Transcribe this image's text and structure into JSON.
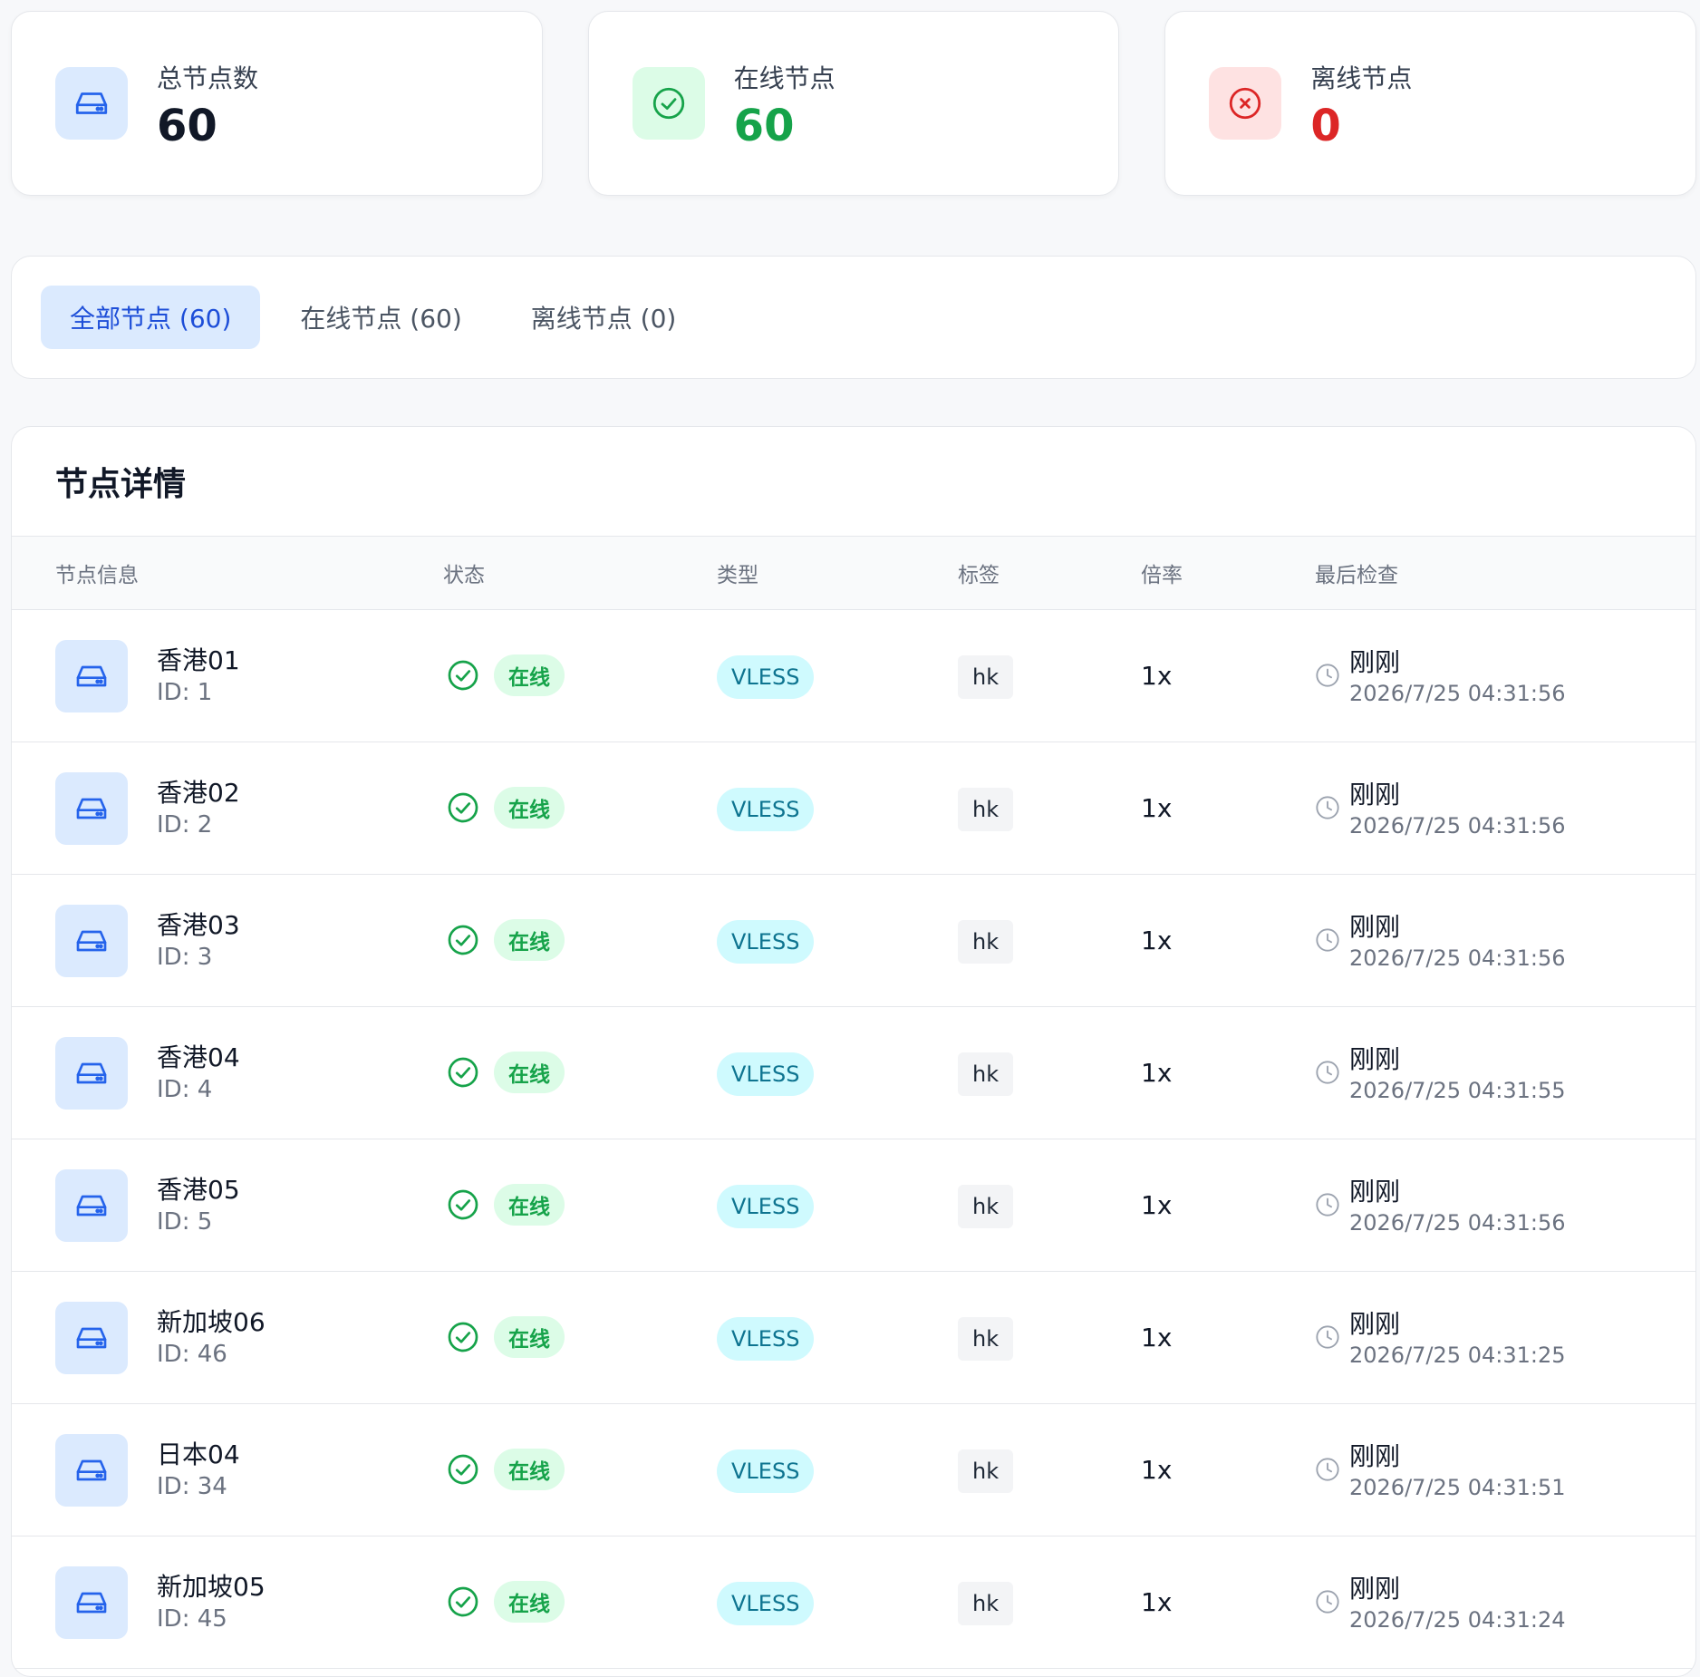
{
  "colors": {
    "blue": "#2563eb",
    "green": "#16a34a",
    "red": "#dc2626"
  },
  "stats": [
    {
      "label": "总节点数",
      "value": "60",
      "icon": "server-icon"
    },
    {
      "label": "在线节点",
      "value": "60",
      "icon": "check-circle-icon"
    },
    {
      "label": "离线节点",
      "value": "0",
      "icon": "x-circle-icon"
    }
  ],
  "tabs": [
    {
      "label": "全部节点 (60)",
      "active": true
    },
    {
      "label": "在线节点 (60)",
      "active": false
    },
    {
      "label": "离线节点 (0)",
      "active": false
    }
  ],
  "detail": {
    "title": "节点详情",
    "columns": [
      "节点信息",
      "状态",
      "类型",
      "标签",
      "倍率",
      "最后检查"
    ]
  },
  "nodes": [
    {
      "name": "香港01",
      "id": "ID: 1",
      "status": "在线",
      "type": "VLESS",
      "tag": "hk",
      "rate": "1x",
      "last": "刚刚",
      "time": "2026/7/25 04:31:56"
    },
    {
      "name": "香港02",
      "id": "ID: 2",
      "status": "在线",
      "type": "VLESS",
      "tag": "hk",
      "rate": "1x",
      "last": "刚刚",
      "time": "2026/7/25 04:31:56"
    },
    {
      "name": "香港03",
      "id": "ID: 3",
      "status": "在线",
      "type": "VLESS",
      "tag": "hk",
      "rate": "1x",
      "last": "刚刚",
      "time": "2026/7/25 04:31:56"
    },
    {
      "name": "香港04",
      "id": "ID: 4",
      "status": "在线",
      "type": "VLESS",
      "tag": "hk",
      "rate": "1x",
      "last": "刚刚",
      "time": "2026/7/25 04:31:55"
    },
    {
      "name": "香港05",
      "id": "ID: 5",
      "status": "在线",
      "type": "VLESS",
      "tag": "hk",
      "rate": "1x",
      "last": "刚刚",
      "time": "2026/7/25 04:31:56"
    },
    {
      "name": "新加坡06",
      "id": "ID: 46",
      "status": "在线",
      "type": "VLESS",
      "tag": "hk",
      "rate": "1x",
      "last": "刚刚",
      "time": "2026/7/25 04:31:25"
    },
    {
      "name": "日本04",
      "id": "ID: 34",
      "status": "在线",
      "type": "VLESS",
      "tag": "hk",
      "rate": "1x",
      "last": "刚刚",
      "time": "2026/7/25 04:31:51"
    },
    {
      "name": "新加坡05",
      "id": "ID: 45",
      "status": "在线",
      "type": "VLESS",
      "tag": "hk",
      "rate": "1x",
      "last": "刚刚",
      "time": "2026/7/25 04:31:24"
    }
  ]
}
